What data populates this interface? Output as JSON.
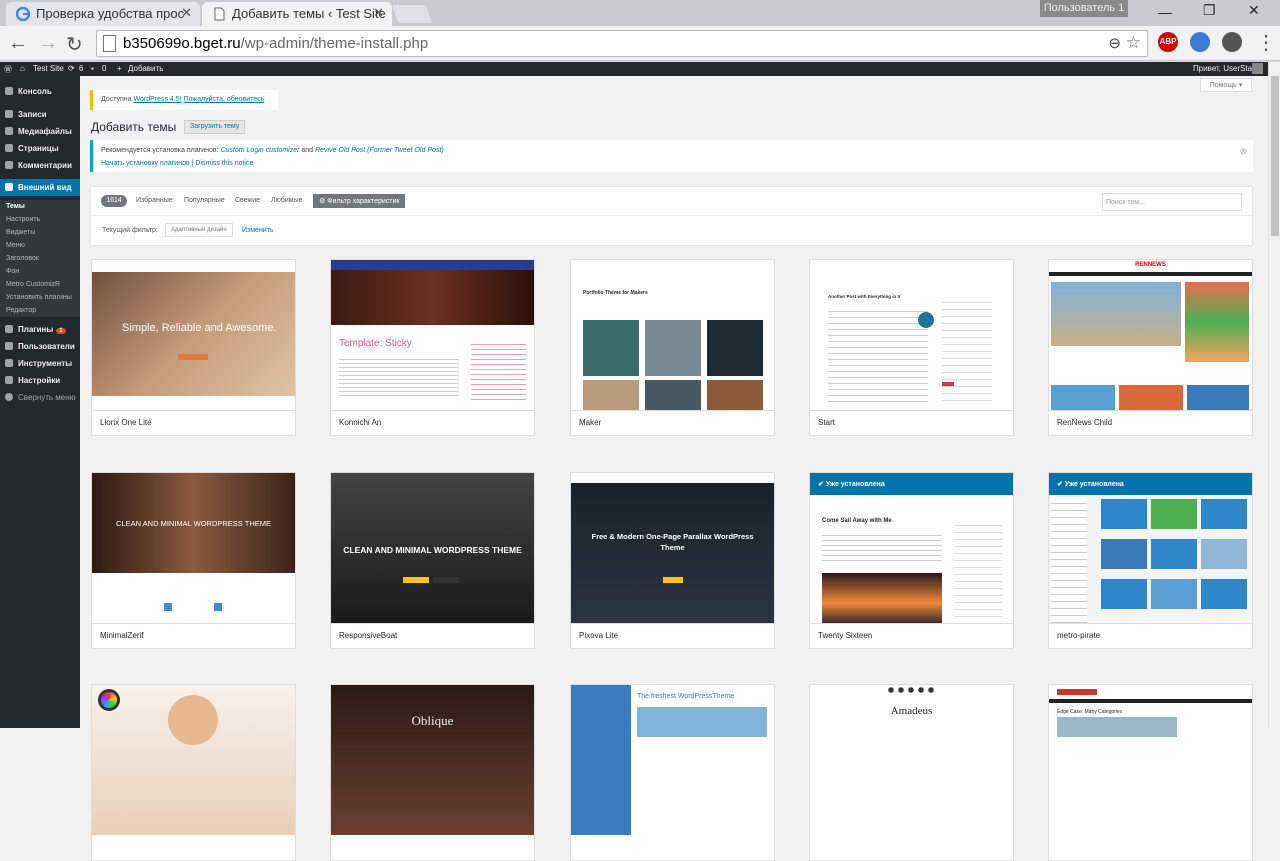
{
  "browser": {
    "tabs": [
      {
        "title": "Проверка удобства прос"
      },
      {
        "title": "Добавить темы ‹ Test Site"
      }
    ],
    "user_label": "Пользователь 1",
    "url_host": "b350699o.bget.ru",
    "url_path": "/wp-admin/theme-install.php",
    "ext_abp": "ABP"
  },
  "adminbar": {
    "site": "Test Site",
    "updates": "6",
    "comments": "0",
    "add_new": "Добавить",
    "greeting": "Привет, UserStar"
  },
  "sidebar": {
    "items": [
      {
        "label": "Консоль"
      },
      {
        "label": "Записи"
      },
      {
        "label": "Медиафайлы"
      },
      {
        "label": "Страницы"
      },
      {
        "label": "Комментарии"
      },
      {
        "label": "Внешний вид"
      },
      {
        "label": "Плагины",
        "badge": "1"
      },
      {
        "label": "Пользователи"
      },
      {
        "label": "Инструменты"
      },
      {
        "label": "Настройки"
      },
      {
        "label": "Свернуть меню"
      }
    ],
    "sub": [
      "Темы",
      "Настроить",
      "Виджеты",
      "Меню",
      "Заголовок",
      "Фон",
      "Metro CustomizR",
      "Установить плагины",
      "Редактор"
    ]
  },
  "main": {
    "help": "Помощь ▾",
    "nag_text": "Доступна ",
    "nag_link1": "WordPress 4.5!",
    "nag_link2": "Пожалуйста, обновитесь",
    "title": "Добавить темы",
    "upload_label": "Загрузить тему",
    "notice_text": "Рекомендуется установка плагинов: ",
    "notice_p1": "Custom Login customizer",
    "notice_and": " and ",
    "notice_p2": "Revive Old Post (Former Tweet Old Post)",
    "notice_link1": "Начать установку плагинов",
    "notice_link2": "Dismiss this notice",
    "dismiss": "⊗"
  },
  "filter": {
    "count": "1614",
    "links": [
      "Избранные",
      "Популярные",
      "Свежие",
      "Любимые"
    ],
    "feature_filter": "Фильтр характеристик",
    "search_placeholder": "Поиск тем...",
    "current_label": "Текущий фильтр:",
    "current_tag": "Адаптивный дизайн",
    "change": "Изменить"
  },
  "themes": [
    {
      "name": "Llorix One Lite",
      "headline": "Simple, Reliable and Awesome."
    },
    {
      "name": "Konnichi An",
      "headline": "Template: Sticky"
    },
    {
      "name": "Maker",
      "headline": "Portfolio Theme for Makers"
    },
    {
      "name": "Start",
      "headline": "Another Post with Everything in It"
    },
    {
      "name": "RenNews Child",
      "headline": "RENNEWS"
    },
    {
      "name": "MinimalZerif",
      "headline": "CLEAN AND MINIMAL WORDPRESS THEME"
    },
    {
      "name": "ResponsiveBoat",
      "headline": "CLEAN AND MINIMAL WORDPRESS THEME"
    },
    {
      "name": "Pixova Lite",
      "headline": "Free & Modern One-Page Parallax WordPress Theme"
    },
    {
      "name": "Twenty Sixteen",
      "headline": "Come Sail Away with Me",
      "installed": "Уже установлена"
    },
    {
      "name": "metro-pirate",
      "headline": "",
      "installed": "Уже установлена"
    },
    {
      "name": "",
      "headline": ""
    },
    {
      "name": "",
      "headline": "Oblique"
    },
    {
      "name": "",
      "headline": "The freshest WordPressTheme"
    },
    {
      "name": "",
      "headline": "Amadeus"
    },
    {
      "name": "",
      "headline": "Edge Case: Many Categories"
    }
  ]
}
